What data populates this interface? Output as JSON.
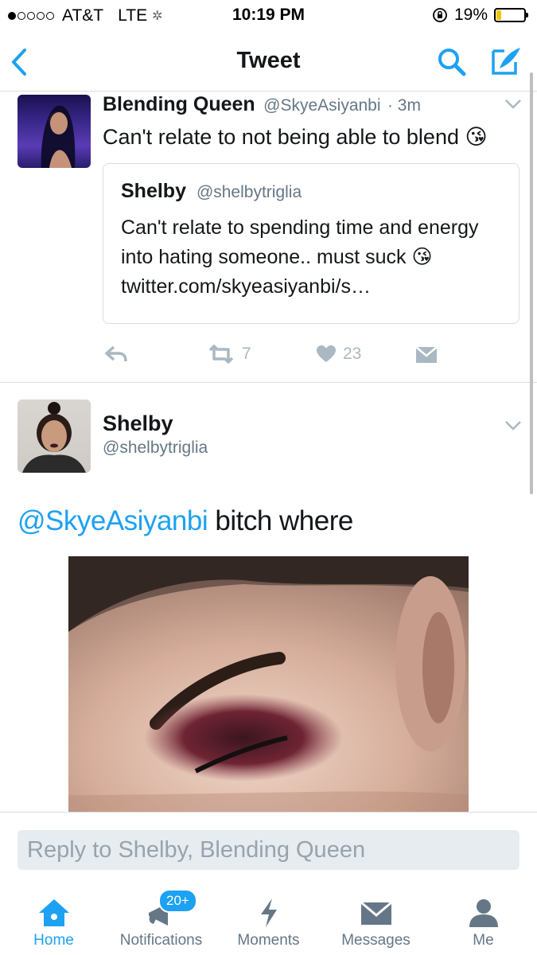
{
  "status_bar": {
    "signal": "●○○○○",
    "carrier": "AT&T",
    "network": "LTE",
    "time": "10:19 PM",
    "battery_percent": "19%",
    "battery_level": 0.19
  },
  "nav": {
    "title": "Tweet",
    "icons": [
      "back-chevron-icon",
      "search-icon",
      "compose-icon"
    ]
  },
  "tweet1": {
    "author_name": "Blending Queen",
    "author_handle": "@SkyeAsiyanbi",
    "time": "· 3m",
    "text": "Can't relate to not being able to blend 😘",
    "quote": {
      "author_name": "Shelby",
      "author_handle": "@shelbytriglia",
      "text": "Can't relate to spending time and energy into hating someone.. must suck 😘 twitter.com/skyeasiyanbi/s…"
    },
    "retweet_count": "7",
    "like_count": "23"
  },
  "tweet2": {
    "author_name": "Shelby",
    "author_handle": "@shelbytriglia",
    "mention": "@SkyeAsiyanbi",
    "text": " bitch where"
  },
  "reply": {
    "placeholder": "Reply to Shelby, Blending Queen"
  },
  "tabs": [
    {
      "label": "Home",
      "icon": "home-icon"
    },
    {
      "label": "Notifications",
      "icon": "notifications-icon",
      "badge": "20+"
    },
    {
      "label": "Moments",
      "icon": "moments-icon"
    },
    {
      "label": "Messages",
      "icon": "messages-icon"
    },
    {
      "label": "Me",
      "icon": "me-icon"
    }
  ],
  "colors": {
    "accent": "#1da1f2",
    "muted": "#657786",
    "icon_gray": "#aab8c2",
    "battery_low": "#f5c400"
  }
}
